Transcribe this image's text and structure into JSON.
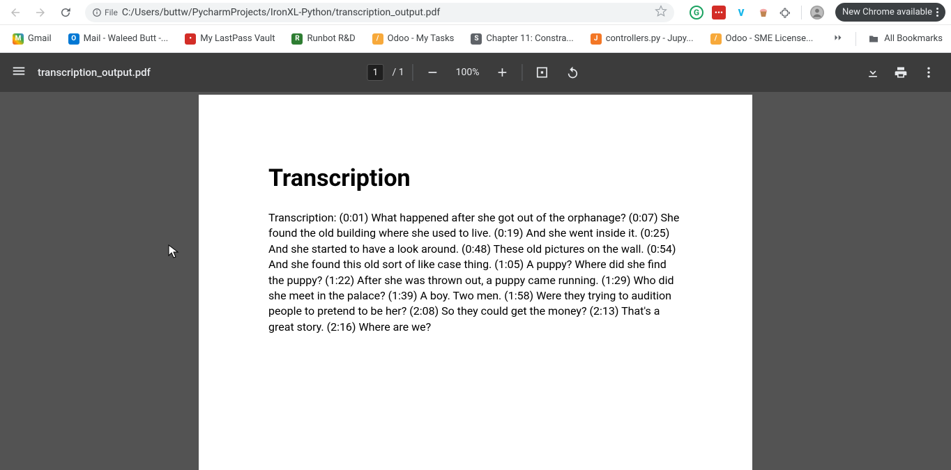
{
  "browser": {
    "file_badge": "File",
    "url": "C:/Users/buttw/PycharmProjects/IronXL-Python/transcription_output.pdf",
    "update_button": "New Chrome available"
  },
  "bookmarks": {
    "items": [
      {
        "label": "Gmail",
        "color": "#ea4335",
        "letter": "M"
      },
      {
        "label": "Mail - Waleed Butt -...",
        "color": "#0078d4",
        "letter": "O"
      },
      {
        "label": "My LastPass Vault",
        "color": "#d32d27",
        "letter": "•"
      },
      {
        "label": "Runbot R&D",
        "color": "#2e7d32",
        "letter": "R"
      },
      {
        "label": "Odoo - My Tasks",
        "color": "#f7a93b",
        "letter": "/"
      },
      {
        "label": "Chapter 11: Constra...",
        "color": "#5f6368",
        "letter": "S"
      },
      {
        "label": "controllers.py - Jupy...",
        "color": "#f37726",
        "letter": "J"
      },
      {
        "label": "Odoo - SME License...",
        "color": "#f7a93b",
        "letter": "/"
      }
    ],
    "all_bookmarks": "All Bookmarks"
  },
  "pdf_toolbar": {
    "filename": "transcription_output.pdf",
    "page_current": "1",
    "page_total": "1",
    "zoom": "100%"
  },
  "document": {
    "heading": "Transcription",
    "body": "Transcription: (0:01) What happened after she got out of the orphanage? (0:07) She found the old building where she used to live. (0:19) And she went inside it. (0:25) And she started to have a look around. (0:48) These old pictures on the wall. (0:54) And she found this old sort of like case thing. (1:05) A puppy? Where did she find the puppy? (1:22) After she was thrown out, a puppy came running. (1:29) Who did she meet in the palace? (1:39) A boy. Two men. (1:58) Were they trying to audition people to pretend to be her? (2:08) So they could get the money? (2:13) That's a great story. (2:16) Where are we?"
  }
}
